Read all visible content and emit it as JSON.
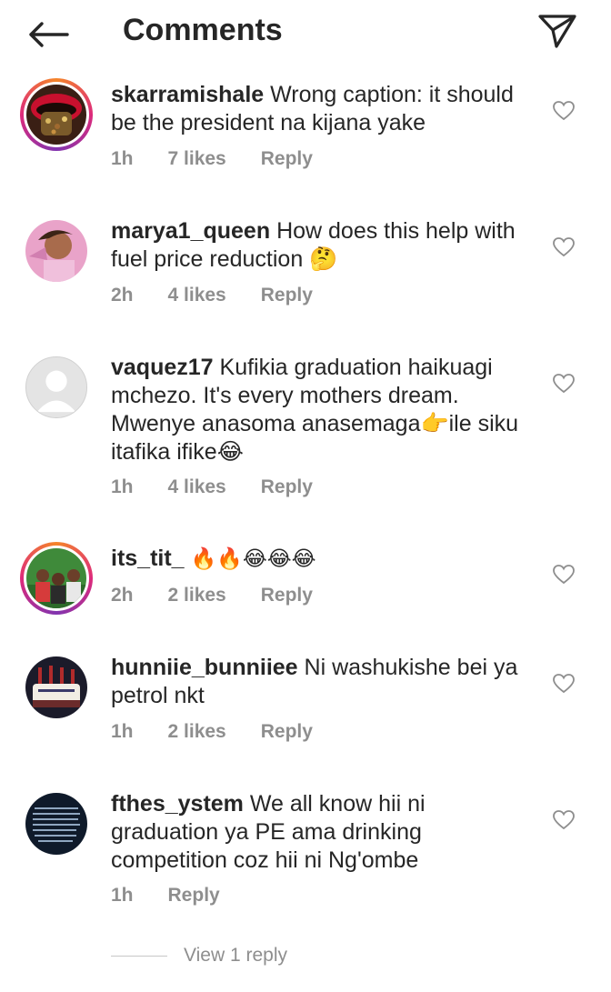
{
  "header": {
    "title": "Comments",
    "back_icon": "back-arrow-icon",
    "send_icon": "send-icon"
  },
  "comments": [
    {
      "username": "skarramishale",
      "text": "Wrong caption: it should be the president na kijana yake",
      "time": "1h",
      "likes": "7 likes",
      "reply": "Reply",
      "avatar": "lips-avatar",
      "story_ring": true
    },
    {
      "username": "marya1_queen",
      "text": "How does this help with fuel price reduction 🤔",
      "time": "2h",
      "likes": "4 likes",
      "reply": "Reply",
      "avatar": "woman-avatar",
      "story_ring": false
    },
    {
      "username": "vaquez17",
      "text": "Kufikia graduation haikuagi mchezo. It's every mothers dream. Mwenye anasoma anasemaga👉ile siku itafika ifike😂",
      "time": "1h",
      "likes": "4 likes",
      "reply": "Reply",
      "avatar": "default-avatar",
      "story_ring": false
    },
    {
      "username": "its_tit_",
      "text": "🔥🔥😂😂😂",
      "time": "2h",
      "likes": "2 likes",
      "reply": "Reply",
      "avatar": "group-avatar",
      "story_ring": true
    },
    {
      "username": "hunniie_bunniiee",
      "text": "Ni washukishe bei ya petrol nkt",
      "time": "1h",
      "likes": "2 likes",
      "reply": "Reply",
      "avatar": "cake-avatar",
      "story_ring": false
    },
    {
      "username": "fthes_ystem",
      "text": "We all know hii ni graduation ya PE ama drinking competition coz hii ni Ng'ombe",
      "time": "1h",
      "likes": "",
      "reply": "Reply",
      "avatar": "text-avatar",
      "story_ring": false
    }
  ],
  "view_replies": "View 1 reply",
  "colors": {
    "text": "#262626",
    "muted": "#8e8e8e",
    "background": "#ffffff"
  }
}
